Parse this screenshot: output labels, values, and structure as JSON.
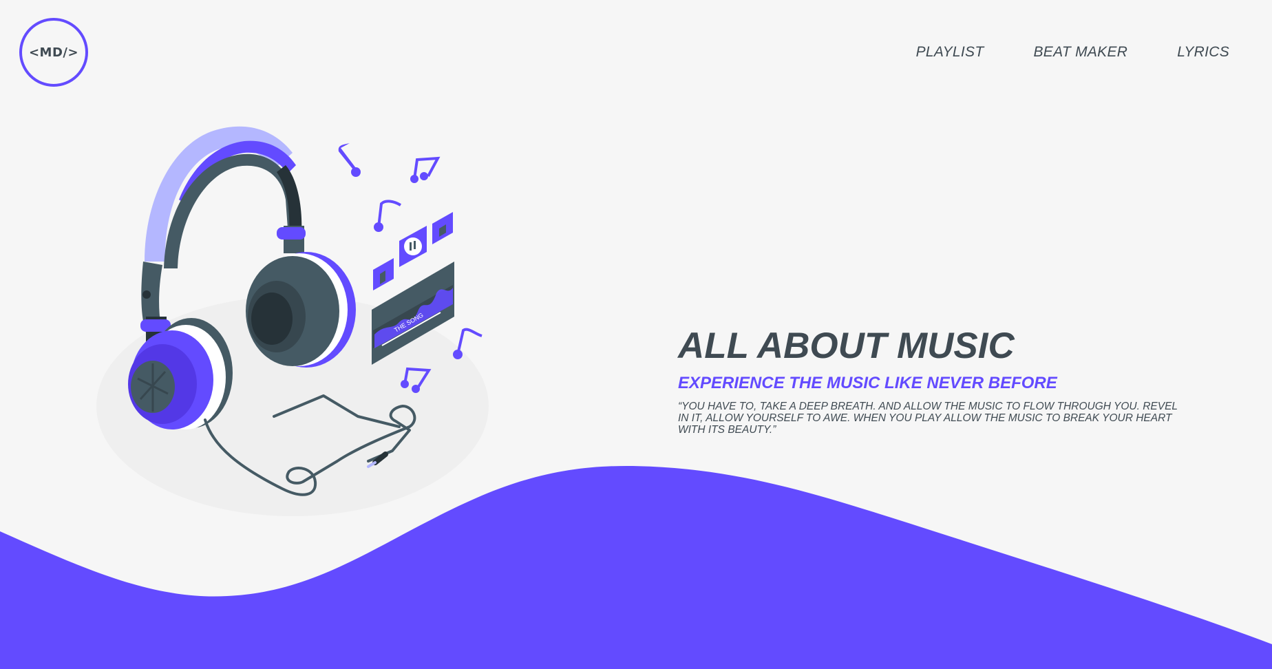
{
  "logo": {
    "text": "<MD/>"
  },
  "nav": {
    "items": [
      {
        "label": "PLAYLIST"
      },
      {
        "label": "BEAT MAKER"
      },
      {
        "label": "LYRICS"
      }
    ]
  },
  "hero": {
    "title": "ALL ABOUT MUSIC",
    "subtitle": "EXPERIENCE THE MUSIC LIKE NEVER BEFORE",
    "quote": "“YOU HAVE TO, TAKE A DEEP BREATH. AND ALLOW THE MUSIC TO FLOW THROUGH YOU. REVEL IN IT, ALLOW YOURSELF TO AWE. WHEN YOU PLAY ALLOW THE MUSIC TO BREAK YOUR HEART WITH ITS BEAUTY.”"
  },
  "illustration": {
    "player_label": "THE SONG",
    "icons": [
      "headphones-icon",
      "music-note-icon",
      "pause-icon",
      "previous-icon",
      "next-icon"
    ]
  },
  "colors": {
    "background": "#f6f6f6",
    "accent": "#634bff",
    "accent_light": "#b4b7ff",
    "text_dark": "#3f4a52",
    "headphone_dark": "#455a64",
    "headphone_darker": "#263238"
  }
}
